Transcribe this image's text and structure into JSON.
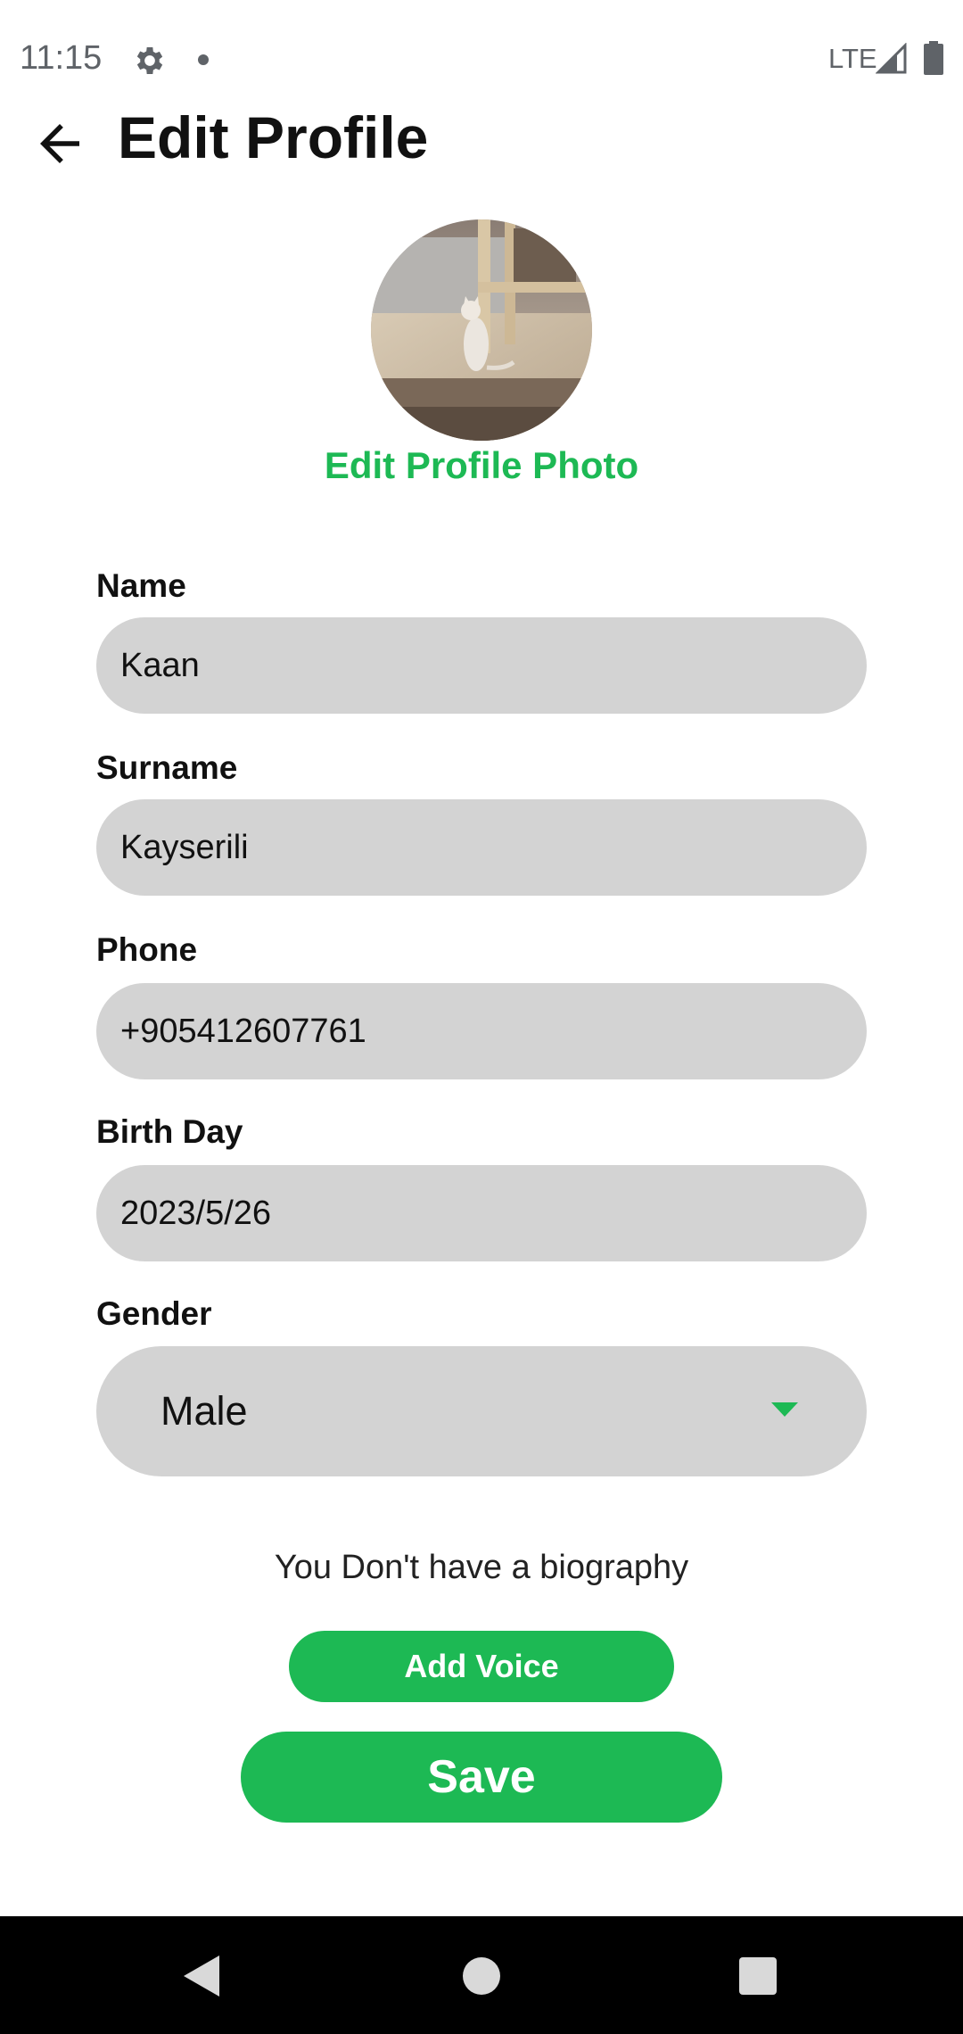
{
  "status_bar": {
    "time": "11:15",
    "network": "LTE"
  },
  "header": {
    "title": "Edit Profile"
  },
  "profile_photo": {
    "edit_label": "Edit Profile Photo"
  },
  "form": {
    "name": {
      "label": "Name",
      "value": "Kaan"
    },
    "surname": {
      "label": "Surname",
      "value": "Kayserili"
    },
    "phone": {
      "label": "Phone",
      "value": "+905412607761"
    },
    "birthday": {
      "label": "Birth Day",
      "value": "2023/5/26"
    },
    "gender": {
      "label": "Gender",
      "value": "Male"
    }
  },
  "bio": {
    "text": "You Don't have a biography"
  },
  "buttons": {
    "add_voice": "Add Voice",
    "save": "Save"
  },
  "colors": {
    "accent": "#1db954",
    "field_bg": "#d3d3d3",
    "navbar": "#000000"
  },
  "icons": [
    "gear-icon",
    "signal-icon",
    "battery-icon",
    "back-arrow-icon",
    "dropdown-caret-icon",
    "nav-back-icon",
    "nav-home-icon",
    "nav-recents-icon"
  ]
}
